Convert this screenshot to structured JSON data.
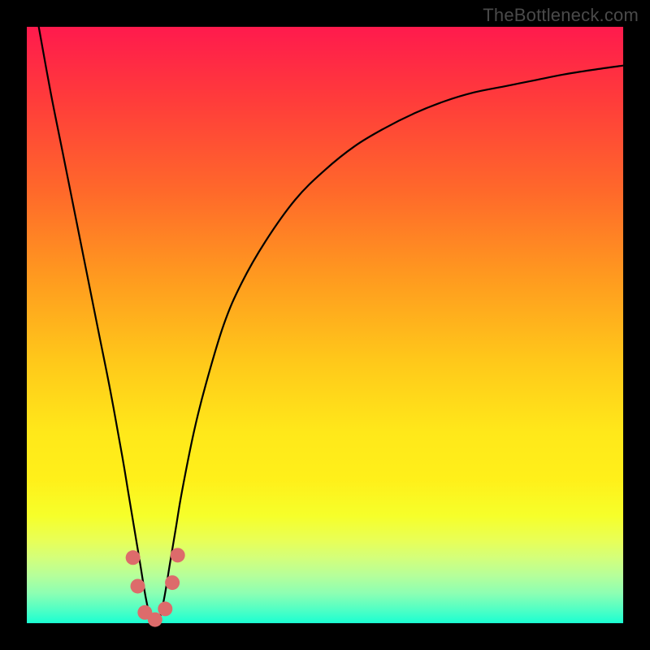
{
  "watermark": "TheBottleneck.com",
  "chart_data": {
    "type": "line",
    "title": "",
    "xlabel": "",
    "ylabel": "",
    "xlim": [
      0,
      100
    ],
    "ylim": [
      0,
      100
    ],
    "grid": false,
    "legend": false,
    "background_gradient": {
      "top": "#ff1a4d",
      "bottom": "#1affd2",
      "stops": [
        "red",
        "orange",
        "yellow",
        "green"
      ]
    },
    "series": [
      {
        "name": "bottleneck-curve",
        "x": [
          2,
          4,
          6,
          8,
          10,
          12,
          14,
          16,
          17,
          18,
          19,
          20,
          21,
          22,
          23,
          24,
          25,
          26,
          28,
          30,
          33,
          36,
          40,
          45,
          50,
          55,
          60,
          65,
          70,
          75,
          80,
          85,
          90,
          95,
          100
        ],
        "y": [
          100,
          89,
          79,
          69,
          59,
          49,
          39,
          28,
          22,
          16,
          10,
          4,
          0,
          0,
          4,
          10,
          16,
          22,
          32,
          40,
          50,
          57,
          64,
          71,
          76,
          80,
          83,
          85.5,
          87.5,
          89,
          90,
          91,
          92,
          92.8,
          93.5
        ]
      }
    ],
    "markers": {
      "name": "trough-points",
      "color": "#dd6b6b",
      "radius_px": 9,
      "points_xy": [
        [
          17.8,
          11.0
        ],
        [
          18.6,
          6.2
        ],
        [
          19.8,
          1.8
        ],
        [
          21.5,
          0.6
        ],
        [
          23.2,
          2.4
        ],
        [
          24.4,
          6.8
        ],
        [
          25.3,
          11.4
        ]
      ]
    }
  }
}
